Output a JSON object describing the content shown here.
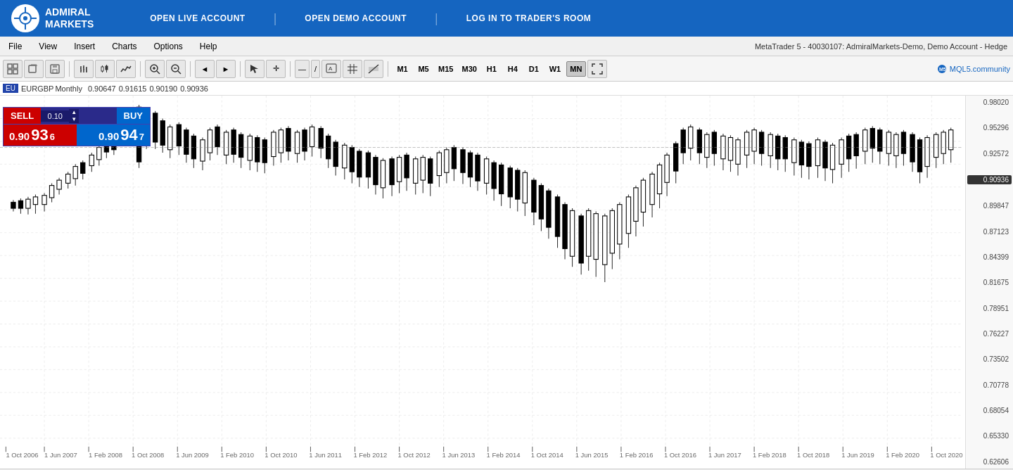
{
  "header": {
    "logo_line1": "ADMIRAL",
    "logo_line2": "MARKETS",
    "links": [
      {
        "label": "OPEN LIVE ACCOUNT",
        "name": "open-live-account"
      },
      {
        "label": "OPEN DEMO ACCOUNT",
        "name": "open-demo-account"
      },
      {
        "label": "LOG IN TO TRADER'S ROOM",
        "name": "login-trader-room"
      }
    ]
  },
  "menu": {
    "items": [
      "File",
      "View",
      "Insert",
      "Charts",
      "Options",
      "Help"
    ],
    "platform_info": "MetaTrader 5 - 40030107: AdmiralMarkets-Demo, Demo Account - Hedge"
  },
  "toolbar": {
    "timeframes": [
      "M1",
      "M5",
      "M15",
      "M30",
      "H1",
      "H4",
      "D1",
      "W1",
      "MN"
    ],
    "active_timeframe": "MN",
    "mql5_label": "MQL5.community"
  },
  "instrument": {
    "symbol": "EURGBP",
    "timeframe": "Monthly",
    "open": "0.90647",
    "high": "0.91615",
    "low": "0.90190",
    "close": "0.90936"
  },
  "trading_panel": {
    "sell_label": "SELL",
    "buy_label": "BUY",
    "lot_size": "0.10",
    "sell_price_main": "0.90",
    "sell_price_big": "93",
    "sell_price_small": "6",
    "buy_price_main": "0.90",
    "buy_price_big": "94",
    "buy_price_small": "7"
  },
  "price_scale": {
    "labels": [
      "0.98020",
      "0.95296",
      "0.92572",
      "0.90936",
      "0.89847",
      "0.87123",
      "0.84399",
      "0.81675",
      "0.78951",
      "0.76227",
      "0.73502",
      "0.70778",
      "0.68054",
      "0.65330",
      "0.62606"
    ],
    "current": "0.90936"
  },
  "time_labels": [
    "1 Oct 2006",
    "1 Jun 2007",
    "1 Feb 2008",
    "1 Oct 2008",
    "1 Jun 2009",
    "1 Feb 2010",
    "1 Oct 2010",
    "1 Jun 2011",
    "1 Feb 2012",
    "1 Oct 2012",
    "1 Jun 2013",
    "1 Feb 2014",
    "1 Oct 2014",
    "1 Jun 2015",
    "1 Feb 2016",
    "1 Oct 2016",
    "1 Jun 2017",
    "1 Feb 2018",
    "1 Oct 2018",
    "1 Jun 2019",
    "1 Feb 2020",
    "1 Oct 2020"
  ],
  "status_bar": {
    "symbol": "EURGBP, Monthly",
    "scroll_arrow_left": "◄",
    "scroll_arrow_right": "►"
  },
  "colors": {
    "header_bg": "#1565C0",
    "bull_candle": "#ffffff",
    "bear_candle": "#000000",
    "chart_bg": "#ffffff",
    "grid": "#dddddd"
  }
}
